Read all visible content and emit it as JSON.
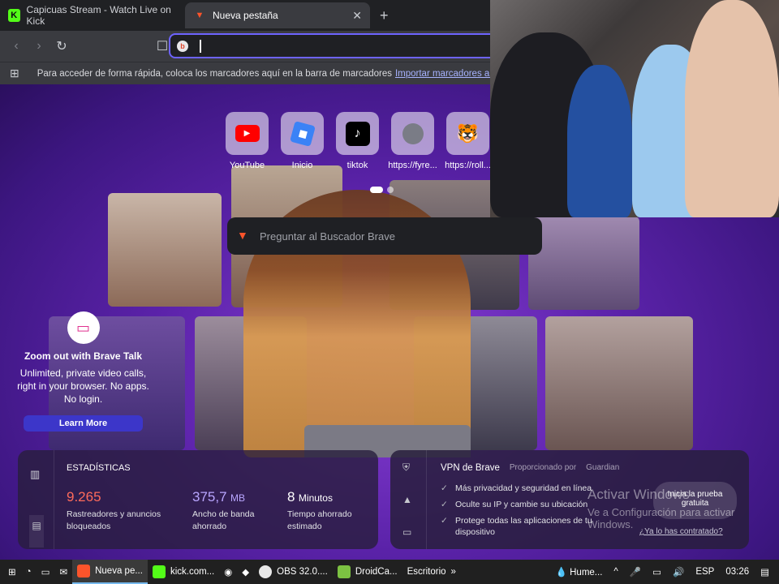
{
  "browser": {
    "tabs": [
      {
        "title": "Capicuas Stream - Watch Live on Kick",
        "icon": "kick-icon"
      },
      {
        "title": "Nueva pestaña",
        "icon": "brave-icon",
        "close": "✕"
      }
    ],
    "new_tab": "+",
    "address_value": "",
    "bookmarks_bar_text": "Para acceder de forma rápida, coloca los marcadores aquí en la barra de marcadores",
    "bookmarks_bar_link": "Importar marcadores ahora"
  },
  "newtab": {
    "shortcuts": [
      {
        "label": "YouTube",
        "icon": "youtube-icon"
      },
      {
        "label": "Inicio",
        "icon": "roblox-icon"
      },
      {
        "label": "tiktok",
        "icon": "tiktok-icon"
      },
      {
        "label": "https://fyre...",
        "icon": "globe-icon"
      },
      {
        "label": "https://roll...",
        "icon": "tiger-icon"
      }
    ],
    "search_placeholder": "Preguntar al Buscador Brave",
    "brave_talk": {
      "title": "Zoom out with Brave Talk",
      "body": "Unlimited, private video calls, right in your browser. No apps. No login.",
      "button": "Learn More"
    },
    "stats": {
      "title": "ESTADÍSTICAS",
      "trackers_value": "9.265",
      "trackers_label": "Rastreadores y anuncios bloqueados",
      "bandwidth_value": "375,7",
      "bandwidth_unit": "MB",
      "bandwidth_label": "Ancho de banda ahorrado",
      "time_value": "8",
      "time_unit": "Minutos",
      "time_label": "Tiempo ahorrado estimado"
    },
    "vpn": {
      "title": "VPN de Brave",
      "provided_by": "Proporcionado por",
      "provider": "Guardian",
      "benefits": [
        "Más privacidad y seguridad en línea",
        "Oculte su IP y cambie su ubicación",
        "Protege todas las aplicaciones de tu dispositivo"
      ],
      "trial_button": "Inicia la prueba gratuita",
      "contracted_link": "¿Ya lo has contratado?"
    },
    "windows_watermark": {
      "line1": "Activar Windows",
      "line2": "Ve a Configuración para activar Windows."
    }
  },
  "taskbar": {
    "apps": [
      {
        "label": "Nueva pe...",
        "color": "#fb542b"
      },
      {
        "label": "kick.com...",
        "color": "#53fc18"
      },
      {
        "label": "OBS 32.0....",
        "color": "#e8e8e8"
      },
      {
        "label": "DroidCa...",
        "color": "#7cc242"
      }
    ],
    "desktop_label": "Escritorio",
    "weather": "Hume...",
    "language": "ESP",
    "time": "03:26"
  }
}
